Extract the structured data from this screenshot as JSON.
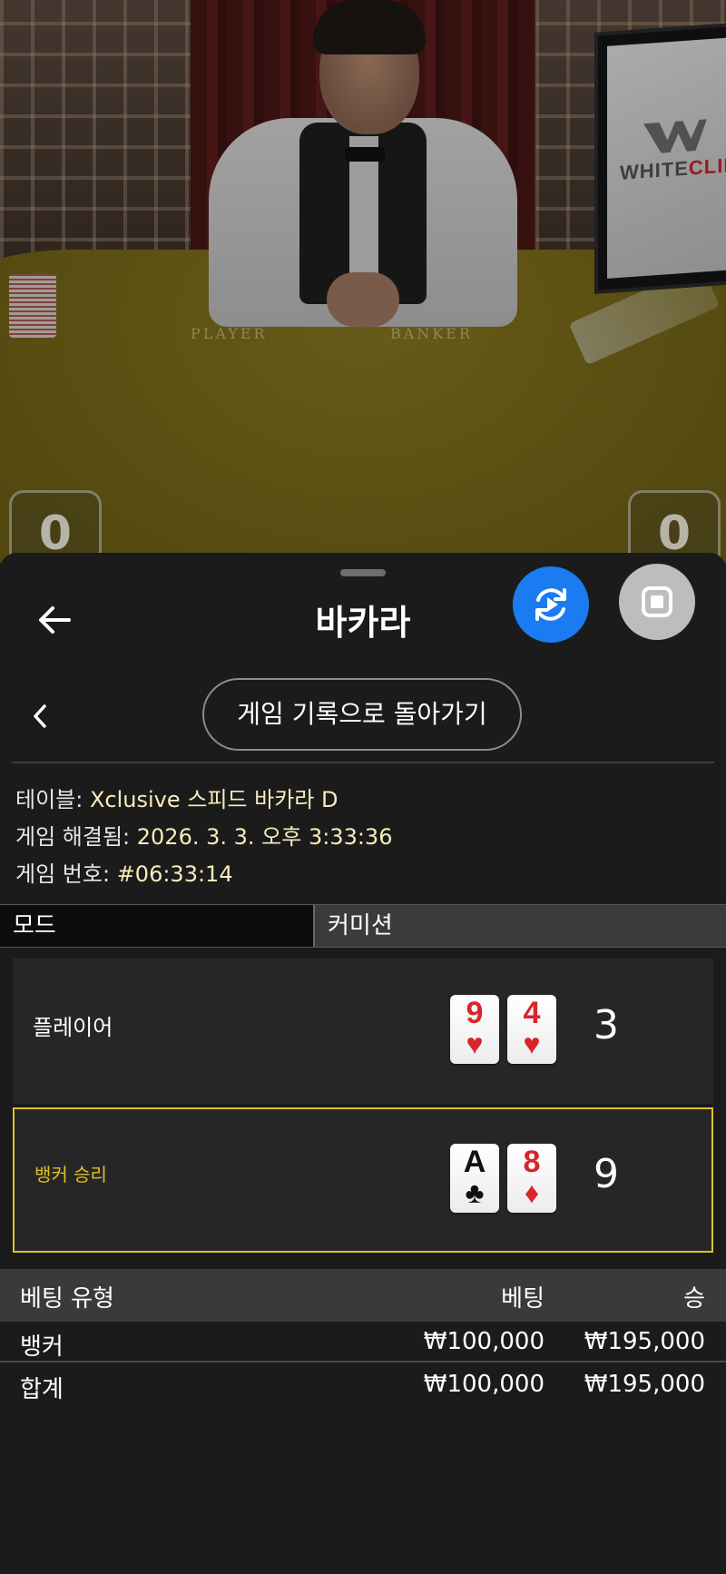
{
  "video": {
    "table_labels": [
      "PLAYER",
      "BANKER"
    ],
    "monitor_brand": "WHITE",
    "monitor_brand_accent": "CLIFF",
    "player_score_display": "0",
    "banker_score_display": "0"
  },
  "header": {
    "title": "바카라",
    "back_icon": "arrow-left-icon",
    "action_icons": [
      "replay-icon",
      "stop-icon"
    ],
    "action_colors": {
      "primary": "#1a7cf0",
      "secondary": "#bdbdbd"
    }
  },
  "history": {
    "back_to_history_label": "게임 기록으로 돌아가기"
  },
  "game_info": {
    "table_label": "테이블:",
    "table_value": "Xclusive 스피드 바카라 D",
    "resolved_label": "게임 해결됨:",
    "resolved_value": "2026. 3. 3. 오후 3:33:36",
    "number_label": "게임 번호:",
    "number_value": "#06:33:14"
  },
  "tabs": {
    "mode": "모드",
    "commission": "커미션"
  },
  "hands": {
    "player": {
      "label": "플레이어",
      "cards": [
        {
          "rank": "9",
          "suit": "♥",
          "color": "red"
        },
        {
          "rank": "4",
          "suit": "♥",
          "color": "red"
        }
      ],
      "score": "3"
    },
    "banker": {
      "label": "뱅커 승리",
      "label_color": "#e0c226",
      "cards": [
        {
          "rank": "A",
          "suit": "♣",
          "color": "black"
        },
        {
          "rank": "8",
          "suit": "♦",
          "color": "red"
        }
      ],
      "score": "9"
    }
  },
  "bets": {
    "headers": {
      "type": "베팅 유형",
      "bet": "베팅",
      "win": "승"
    },
    "rows": [
      {
        "type": "뱅커",
        "bet": "₩100,000",
        "win": "₩195,000"
      }
    ],
    "total": {
      "type": "합계",
      "bet": "₩100,000",
      "win": "₩195,000"
    }
  }
}
